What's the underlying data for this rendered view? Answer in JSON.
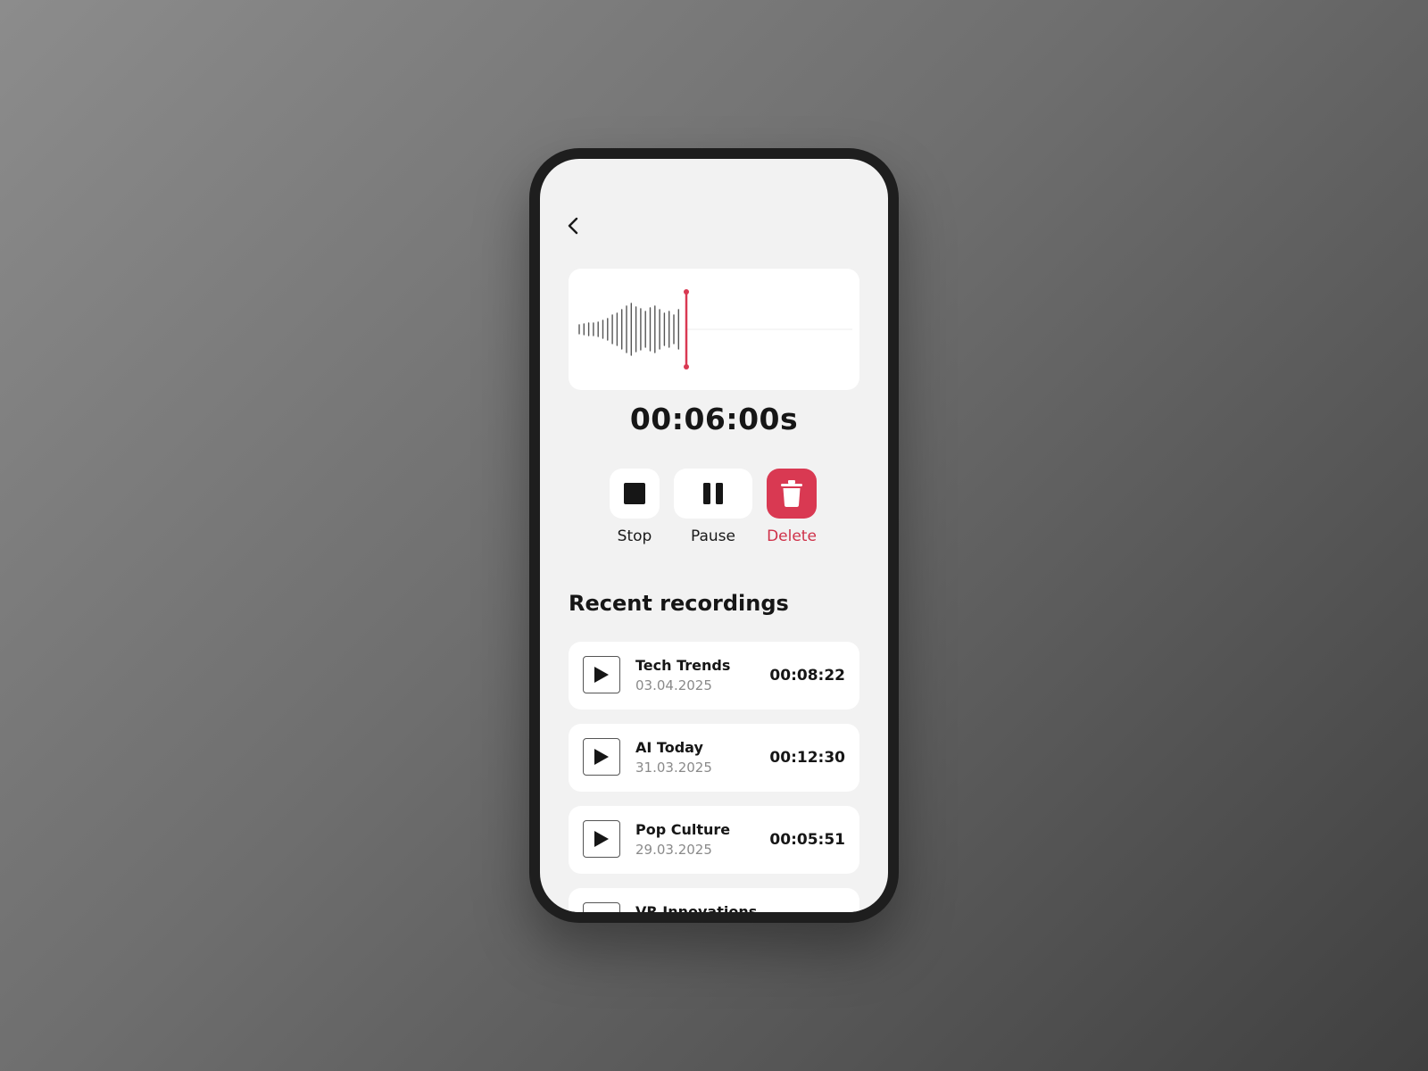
{
  "recorder": {
    "elapsed": "00:06:00s",
    "playhead_color": "#d93952"
  },
  "controls": {
    "stop_label": "Stop",
    "pause_label": "Pause",
    "delete_label": "Delete",
    "delete_color": "#d93952"
  },
  "recent": {
    "title": "Recent recordings",
    "items": [
      {
        "name": "Tech Trends",
        "date": "03.04.2025",
        "duration": "00:08:22"
      },
      {
        "name": "AI Today",
        "date": "31.03.2025",
        "duration": "00:12:30"
      },
      {
        "name": "Pop Culture",
        "date": "29.03.2025",
        "duration": "00:05:51"
      },
      {
        "name": "VR Innovations",
        "date": "",
        "duration": ""
      }
    ]
  },
  "icons": {
    "back": "chevron-left-icon",
    "stop": "stop-square-icon",
    "pause": "pause-icon",
    "delete": "trash-icon",
    "play": "play-icon"
  }
}
